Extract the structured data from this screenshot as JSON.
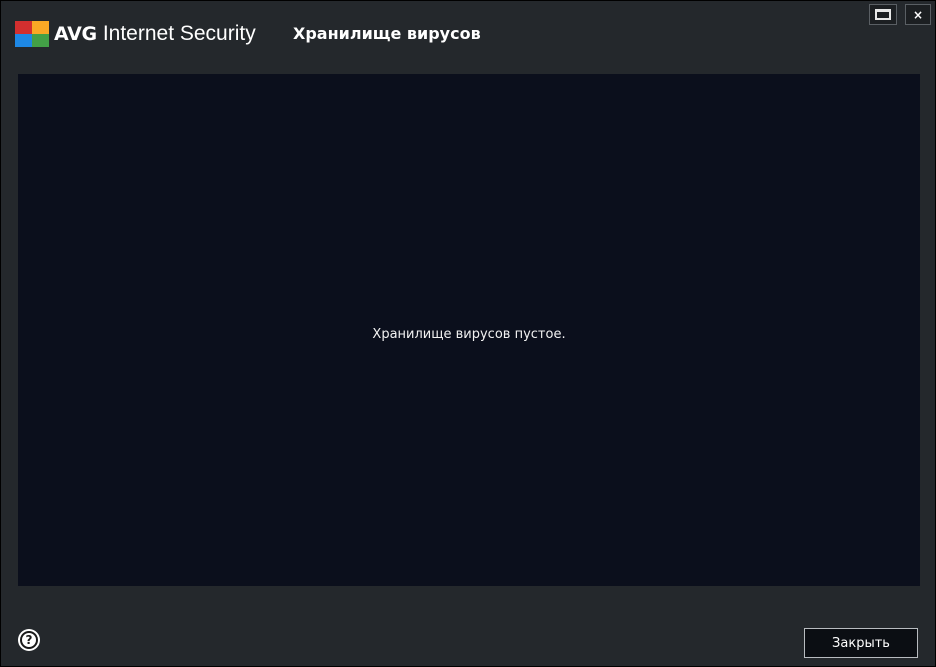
{
  "header": {
    "brand": "AVG",
    "product": "Internet Security",
    "window_title": "Хранилище вирусов",
    "logo_icon": "avg-logo-icon",
    "logo_colors": [
      "#d32f2f",
      "#f9a825",
      "#43a047",
      "#1e88e5"
    ]
  },
  "window_controls": {
    "maximize_icon": "maximize-icon",
    "close_glyph": "×"
  },
  "main": {
    "empty_message": "Хранилище вирусов пустое."
  },
  "footer": {
    "help_icon": "help-icon",
    "help_glyph": "?",
    "close_label": "Закрыть"
  },
  "colors": {
    "window_bg": "#24282c",
    "content_bg": "#0b0f1c",
    "text": "#ffffff"
  }
}
